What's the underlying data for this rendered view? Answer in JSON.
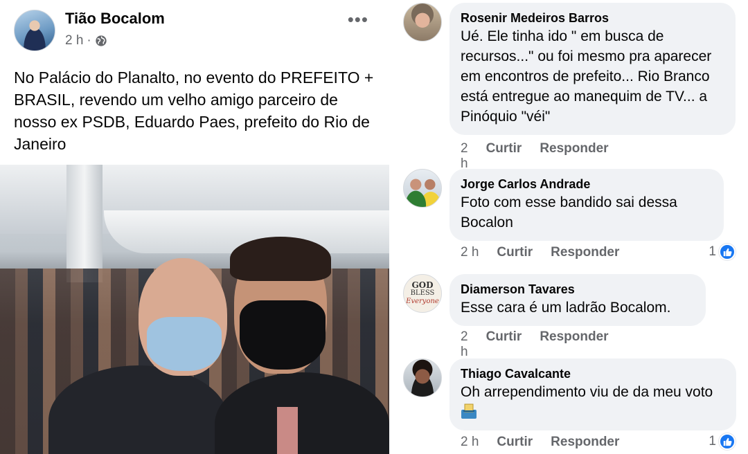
{
  "post": {
    "author": "Tião Bocalom",
    "time": "2 h",
    "separator": "·",
    "privacy_icon": "globe-icon",
    "more_icon": "•••",
    "text": "No Palácio do Planalto,  no evento do PREFEITO + BRASIL, revendo um velho amigo parceiro de nosso ex PSDB, Eduardo Paes, prefeito do Rio de Janeiro"
  },
  "comments": [
    {
      "name": "Rosenir Medeiros Barros",
      "text": "Ué.   Ele tinha ido \" em busca de recursos...\" ou foi mesmo pra aparecer em encontros de prefeito... Rio Branco  está entregue ao manequim de TV... a Pinóquio \"véi\"",
      "time": "2 h",
      "like_label": "Curtir",
      "reply_label": "Responder"
    },
    {
      "name": "Jorge Carlos Andrade",
      "text": "Foto com esse bandido sai dessa Bocalon",
      "time": "2 h",
      "like_label": "Curtir",
      "reply_label": "Responder",
      "reaction_count": "1"
    },
    {
      "name": "Diamerson Tavares",
      "text": "Esse cara é um ladrão  Bocalom.",
      "time": "2 h",
      "like_label": "Curtir",
      "reply_label": "Responder",
      "avatar_text": [
        "GOD",
        "BLESS",
        "Everyone"
      ]
    },
    {
      "name": "Thiago Cavalcante",
      "text": "Oh arrependimento viu de da meu voto",
      "time": "2 h",
      "like_label": "Curtir",
      "reply_label": "Responder",
      "reaction_count": "1",
      "emoji": "ballot-box-icon"
    }
  ],
  "colors": {
    "like_blue": "#1877f2",
    "bubble_bg": "#f0f2f5",
    "secondary_text": "#65676b"
  }
}
